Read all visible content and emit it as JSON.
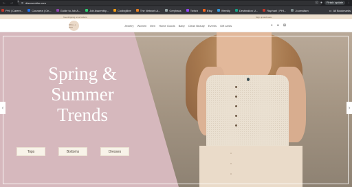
{
  "browser": {
    "back": "←",
    "forward": "→",
    "reload": "↻",
    "lock": "⚿",
    "url": "discoverkim.com",
    "finish_update": "Finish update",
    "all_bookmarks": "All Bookmarks",
    "bookmarks": [
      {
        "label": "PHI | Career...",
        "color": "#c0392b"
      },
      {
        "label": "Coursera | On...",
        "color": "#1f6feb"
      },
      {
        "label": "Guide to Job A...",
        "color": "#8e44ad"
      },
      {
        "label": "Job Assembly...",
        "color": "#2ecc71"
      },
      {
        "label": "CodingBee",
        "color": "#f39c12"
      },
      {
        "label": "The Network A...",
        "color": "#e67e22"
      },
      {
        "label": "Greyhaus",
        "color": "#95a5a6"
      },
      {
        "label": "Twitch",
        "color": "#9146ff"
      },
      {
        "label": "Etsy",
        "color": "#f1641e"
      },
      {
        "label": "Weekly",
        "color": "#3498db"
      },
      {
        "label": "Destination U...",
        "color": "#16a085"
      },
      {
        "label": "Raphael | PHI...",
        "color": "#c0392b"
      },
      {
        "label": "Journalism",
        "color": "#7f8c8d"
      }
    ]
  },
  "promo": {
    "left": "free shipping on all orders",
    "right": "Sign up and save"
  },
  "site": {
    "logo": "Khia + Kim",
    "menu": [
      "Jewelry",
      "Women",
      "Men",
      "Home Goods",
      "Baby",
      "Clean Beauty",
      "Events",
      "Gift cards"
    ],
    "icons": {
      "search": "⌕",
      "account": "☺",
      "cart": "⊞"
    }
  },
  "hero": {
    "headline": "Spring & Summer Trends",
    "buttons": [
      "Tops",
      "Bottoms",
      "Dresses"
    ],
    "prev": "‹",
    "next": "›"
  },
  "colors": {
    "panel": "#d6b8bd",
    "cta_bg": "#f8f3e9",
    "promo_bg": "#ede0cf"
  }
}
